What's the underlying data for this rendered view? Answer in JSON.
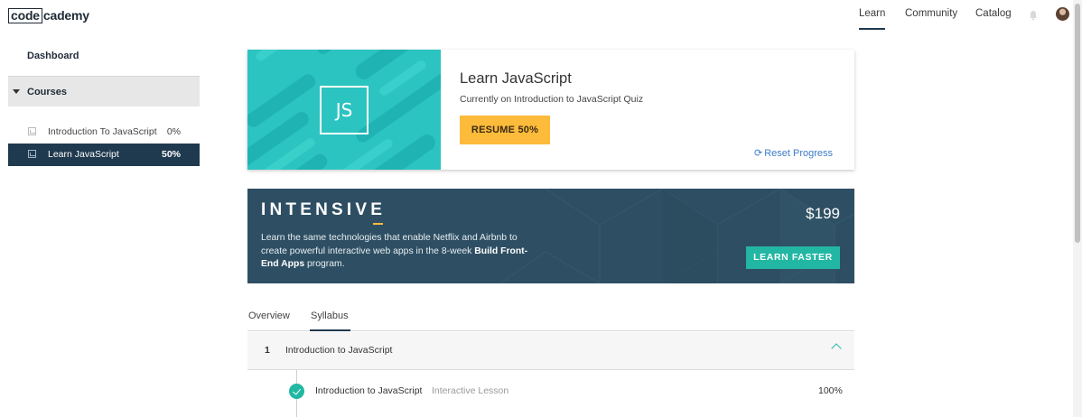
{
  "logo": {
    "boxed": "code",
    "rest": "cademy"
  },
  "nav": {
    "learn": "Learn",
    "community": "Community",
    "catalog": "Catalog",
    "bell_icon": "bell-icon",
    "avatar_icon": "user-avatar"
  },
  "sidebar": {
    "dashboard": "Dashboard",
    "courses_header": "Courses",
    "courses": [
      {
        "name": "Introduction To JavaScript",
        "percent": "0%",
        "icon": "course-image-icon",
        "active": false
      },
      {
        "name": "Learn JavaScript",
        "percent": "50%",
        "icon": "course-image-icon",
        "active": true
      }
    ]
  },
  "course_card": {
    "badge": "JS",
    "title": "Learn JavaScript",
    "subtitle": "Currently on Introduction to JavaScript Quiz",
    "resume_button": "RESUME 50%",
    "reset_icon": "refresh-icon",
    "reset_link": "Reset Progress"
  },
  "intensive": {
    "title": "INTENSIVE",
    "desc_part1": "Learn the same technologies that enable Netflix and Airbnb to create powerful interactive web apps in the 8-week",
    "desc_bold": "Build Front-End Apps",
    "desc_part2": "program.",
    "price": "$199",
    "button": "LEARN FASTER"
  },
  "tabs": [
    "Overview",
    "Syllabus"
  ],
  "active_tab": "Syllabus",
  "syllabus": {
    "unit_number": "1",
    "unit_title": "Introduction to JavaScript",
    "lessons": [
      {
        "title": "Introduction to JavaScript",
        "type": "Interactive Lesson",
        "progress": "100%",
        "completed": true
      }
    ]
  },
  "colors": {
    "navy": "#1f3a4f",
    "teal": "#22b7a3",
    "yellow": "#fcbb3a",
    "banner": "#2e4f63",
    "link": "#3d7cc9"
  }
}
